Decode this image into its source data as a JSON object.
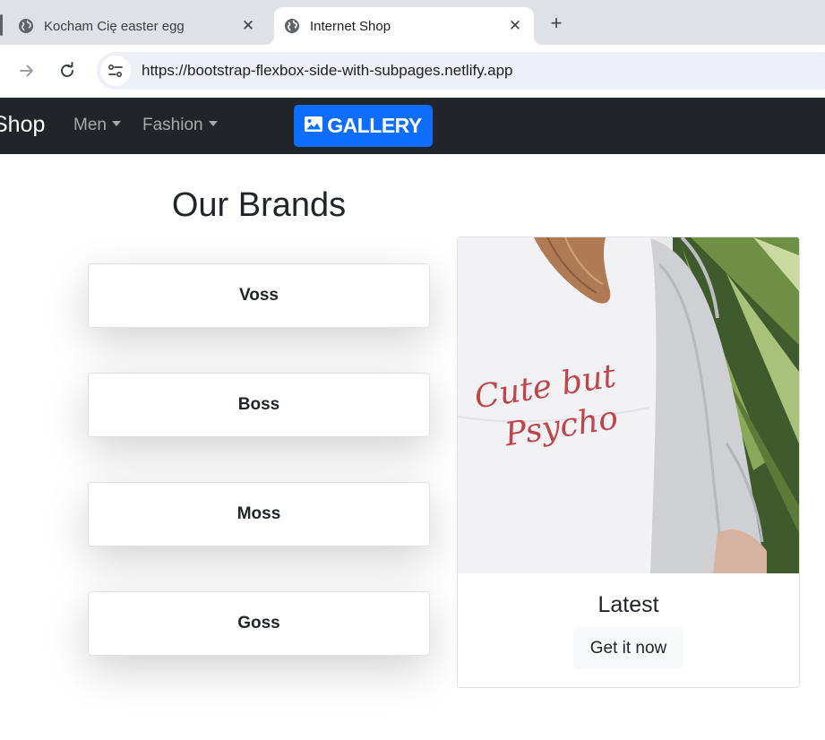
{
  "browser": {
    "tabs": [
      {
        "title": "Kocham Cię easter egg",
        "active": false,
        "icon": "globe-icon"
      },
      {
        "title": "Internet Shop",
        "active": true,
        "icon": "globe-icon"
      }
    ],
    "url": "https://bootstrap-flexbox-side-with-subpages.netlify.app"
  },
  "navbar": {
    "brand": "Shop",
    "links": [
      "Men",
      "Fashion"
    ],
    "gallery_button": "GALLERY",
    "background": "#212529",
    "accent": "#0d6efd"
  },
  "main": {
    "heading": "Our Brands",
    "brands": [
      "Voss",
      "Boss",
      "Moss",
      "Goss"
    ]
  },
  "latest": {
    "image_text": "Cute but Psycho",
    "title": "Latest",
    "button": "Get it now"
  }
}
